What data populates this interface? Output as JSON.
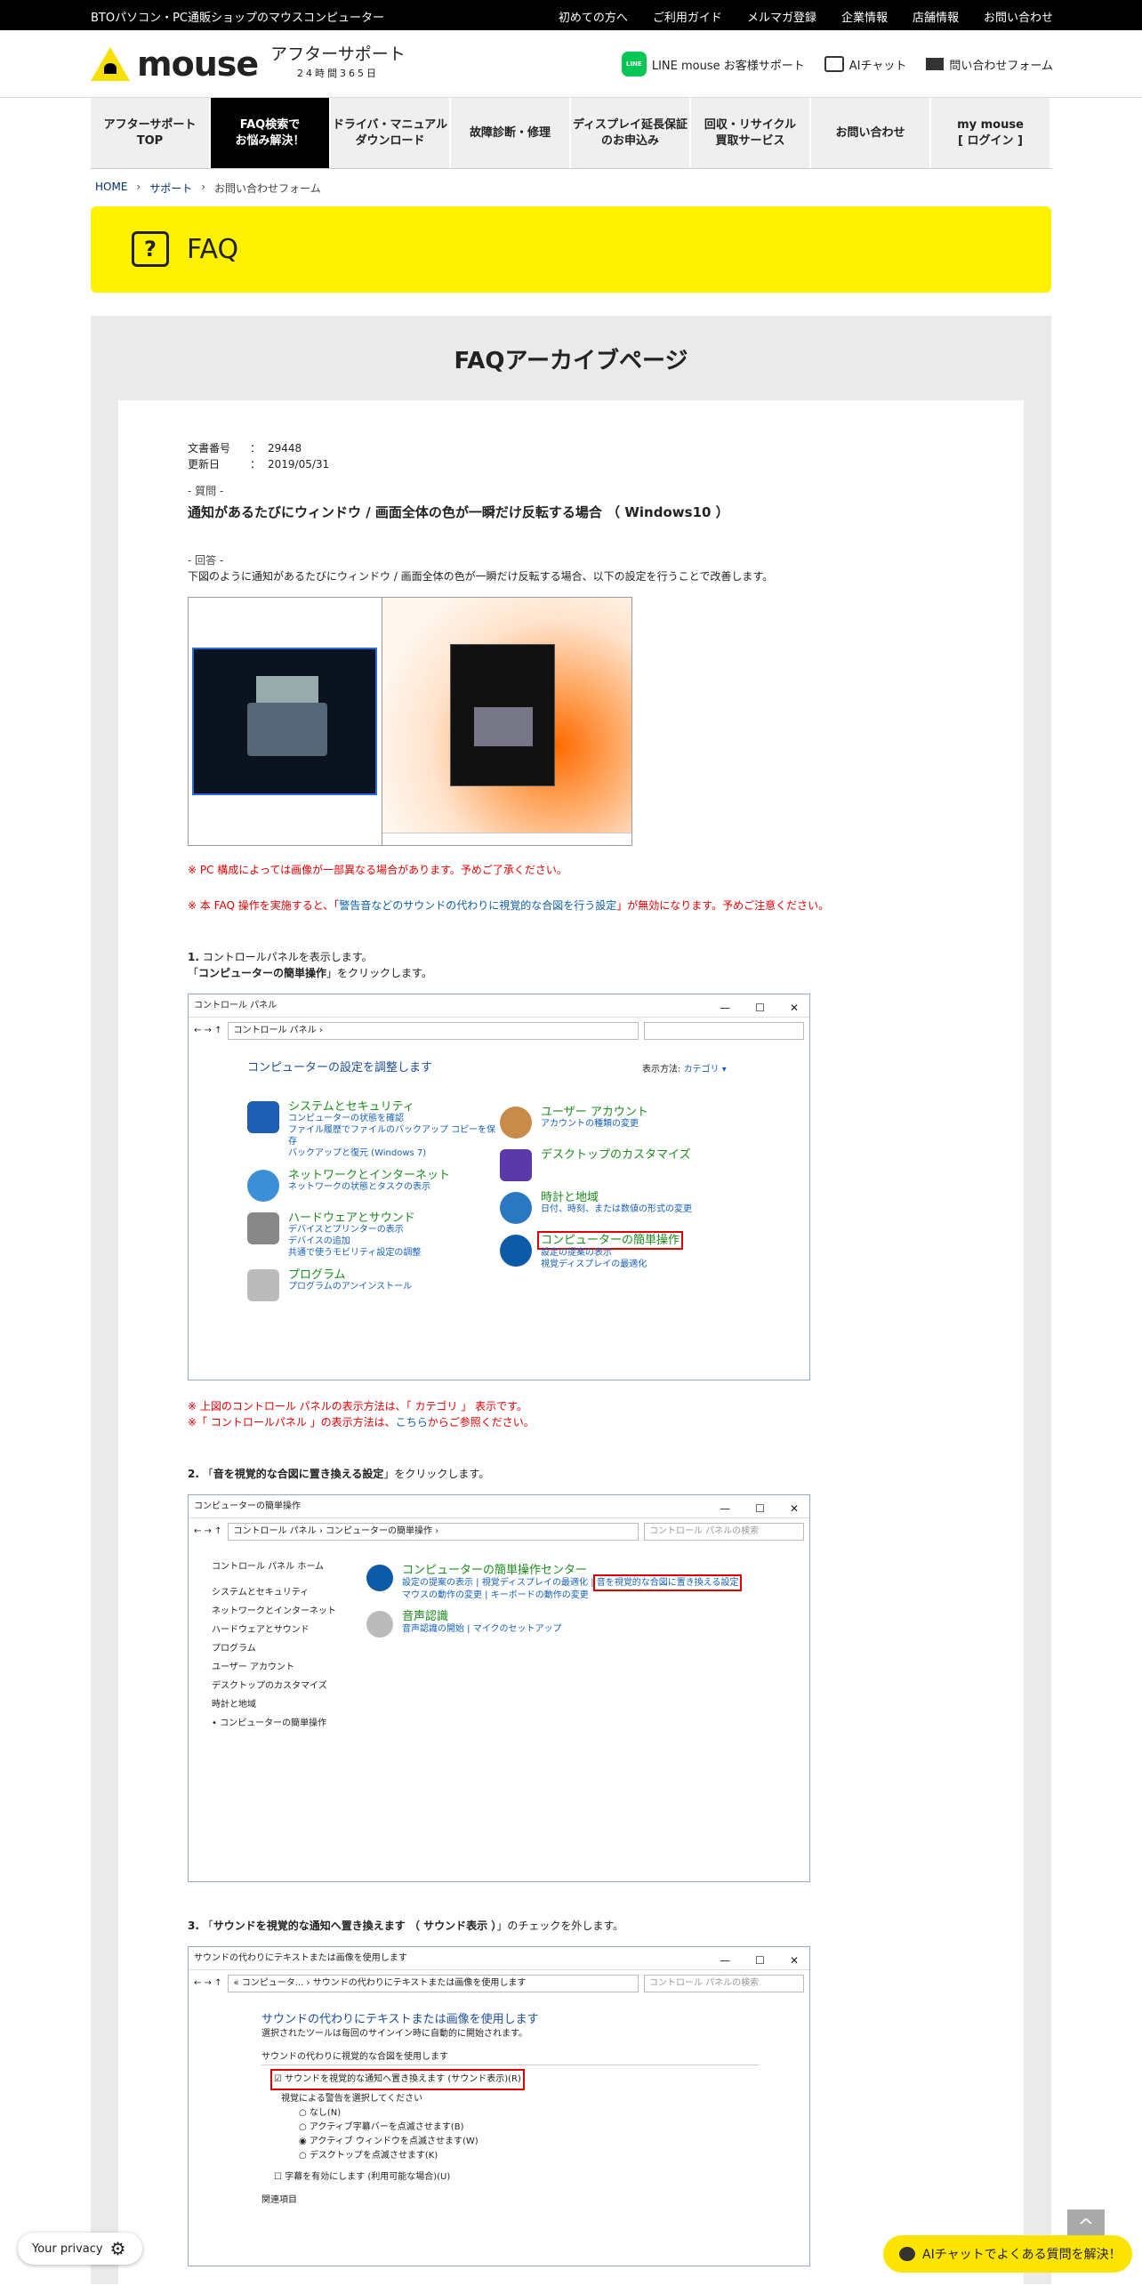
{
  "topbar": {
    "brand": "BTOパソコン・PC通販ショップのマウスコンピューター",
    "links": [
      "初めての方へ",
      "ご利用ガイド",
      "メルマガ登録",
      "企業情報",
      "店舗情報",
      "お問い合わせ"
    ]
  },
  "header": {
    "logo": "mouse",
    "sub": "アフターサポート",
    "sub2": "24時間365日",
    "line_icon": "LINE",
    "line": "LINE mouse お客様サポート",
    "ai": "AIチャット",
    "mail": "問い合わせフォーム"
  },
  "nav": [
    "アフターサポート\nTOP",
    "FAQ検索で\nお悩み解決！",
    "ドライバ・マニュアル\nダウンロード",
    "故障診断・修理",
    "ディスプレイ延長保証\nのお申込み",
    "回収・リサイクル\n買取サービス",
    "お問い合わせ",
    "my mouse\n[ ログイン ]"
  ],
  "breadcrumb": [
    "HOME",
    "サポート",
    "お問い合わせフォーム"
  ],
  "banner": {
    "icon": "?",
    "title": "FAQ"
  },
  "archive_title": "FAQアーカイブページ",
  "doc": {
    "num_label": "文書番号",
    "num": "29448",
    "date_label": "更新日",
    "date": "2019/05/31",
    "colon": "：",
    "q_label": "- 質問 -",
    "q_title": "通知があるたびにウィンドウ / 画面全体の色が一瞬だけ反転する場合 （ Windows10 ）",
    "a_label": "- 回答 -",
    "a_text": "下図のように通知があるたびにウィンドウ / 画面全体の色が一瞬だけ反転する場合、以下の設定を行うことで改善します。",
    "note1": "※ PC 構成によっては画像が一部異なる場合があります。予めご了承ください。",
    "note2a": "※ 本 FAQ 操作を実施すると、「",
    "note2b": "警告音などのサウンドの代わりに視覚的な合図を行う設定",
    "note2c": "」が無効になります。予めご注意ください。",
    "s1_num": "1.",
    "s1a": "コントロールパネルを表示します。",
    "s1b_pre": "「",
    "s1b_bold": "コンピューターの簡単操作",
    "s1b_post": "」をクリックします。",
    "s1_note1": "※ 上図のコントロール パネルの表示方法は、「 カテゴリ 」 表示です。",
    "s1_note2a": "※「 コントロールパネル 」の表示方法は、",
    "s1_note2b": "こちら",
    "s1_note2c": "からご参照ください。",
    "s2_num": "2.",
    "s2_pre": "「",
    "s2_bold": "音を視覚的な合図に置き換える設定",
    "s2_post": "」をクリックします。",
    "s3_num": "3.",
    "s3_pre": "「",
    "s3_bold": "サウンドを視覚的な通知へ置き換えます （ サウンド表示 ）",
    "s3_post": "」のチェックを外します。"
  },
  "ss1": {
    "title": "コントロール パネル",
    "crumb": "コントロール パネル ›",
    "heading": "コンピューターの設定を調整します",
    "view_label": "表示方法:",
    "view_value": "カテゴリ ▾",
    "left": [
      {
        "t": "システムとセキュリティ",
        "subs": [
          "コンピューターの状態を確認",
          "ファイル履歴でファイルのバックアップ コピーを保存",
          "バックアップと復元 (Windows 7)"
        ]
      },
      {
        "t": "ネットワークとインターネット",
        "subs": [
          "ネットワークの状態とタスクの表示"
        ]
      },
      {
        "t": "ハードウェアとサウンド",
        "subs": [
          "デバイスとプリンターの表示",
          "デバイスの追加",
          "共通で使うモビリティ設定の調整"
        ]
      },
      {
        "t": "プログラム",
        "subs": [
          "プログラムのアンインストール"
        ]
      }
    ],
    "right": [
      {
        "t": "ユーザー アカウント",
        "subs": [
          "アカウントの種類の変更"
        ]
      },
      {
        "t": "デスクトップのカスタマイズ",
        "subs": []
      },
      {
        "t": "時計と地域",
        "subs": [
          "日付、時刻、または数値の形式の変更"
        ]
      },
      {
        "t": "コンピューターの簡単操作",
        "subs": [
          "設定の提案の表示",
          "視覚ディスプレイの最適化"
        ]
      }
    ]
  },
  "ss2": {
    "title": "コンピューターの簡単操作",
    "crumb": "コントロール パネル › コンピューターの簡単操作 ›",
    "search": "コントロール パネルの検索",
    "side": [
      "コントロール パネル ホーム",
      "システムとセキュリティ",
      "ネットワークとインターネット",
      "ハードウェアとサウンド",
      "プログラム",
      "ユーザー アカウント",
      "デスクトップのカスタマイズ",
      "時計と地域",
      "コンピューターの簡単操作"
    ],
    "c1": "コンピューターの簡単操作センター",
    "c1_links": [
      "設定の提案の表示",
      "視覚ディスプレイの最適化",
      "音を視覚的な合図に置き換える設定",
      "マウスの動作の変更",
      "キーボードの動作の変更"
    ],
    "c2": "音声認識",
    "c2_links": [
      "音声認識の開始",
      "マイクのセットアップ"
    ]
  },
  "ss3": {
    "title": "サウンドの代わりにテキストまたは画像を使用します",
    "crumb": "« コンピュータ... › サウンドの代わりにテキストまたは画像を使用します",
    "search": "コントロール パネルの検索",
    "heading": "サウンドの代わりにテキストまたは画像を使用します",
    "desc": "選択されたツールは毎回のサインイン時に自動的に開始されます。",
    "group": "サウンドの代わりに視覚的な合図を使用します",
    "check": "サウンドを視覚的な通知へ置き換えます (サウンド表示)(R)",
    "sub": "視覚による警告を選択してください",
    "radios": [
      "なし(N)",
      "アクティブ字幕バーを点滅させます(B)",
      "アクティブ ウィンドウを点滅させます(W)",
      "デスクトップを点滅させます(K)"
    ],
    "caption": "字幕を有効にします (利用可能な場合)(U)",
    "related": "関連項目"
  },
  "widgets": {
    "privacy": "Your privacy",
    "ai": "AIチャットでよくある質問を解決！",
    "totop": "^"
  }
}
